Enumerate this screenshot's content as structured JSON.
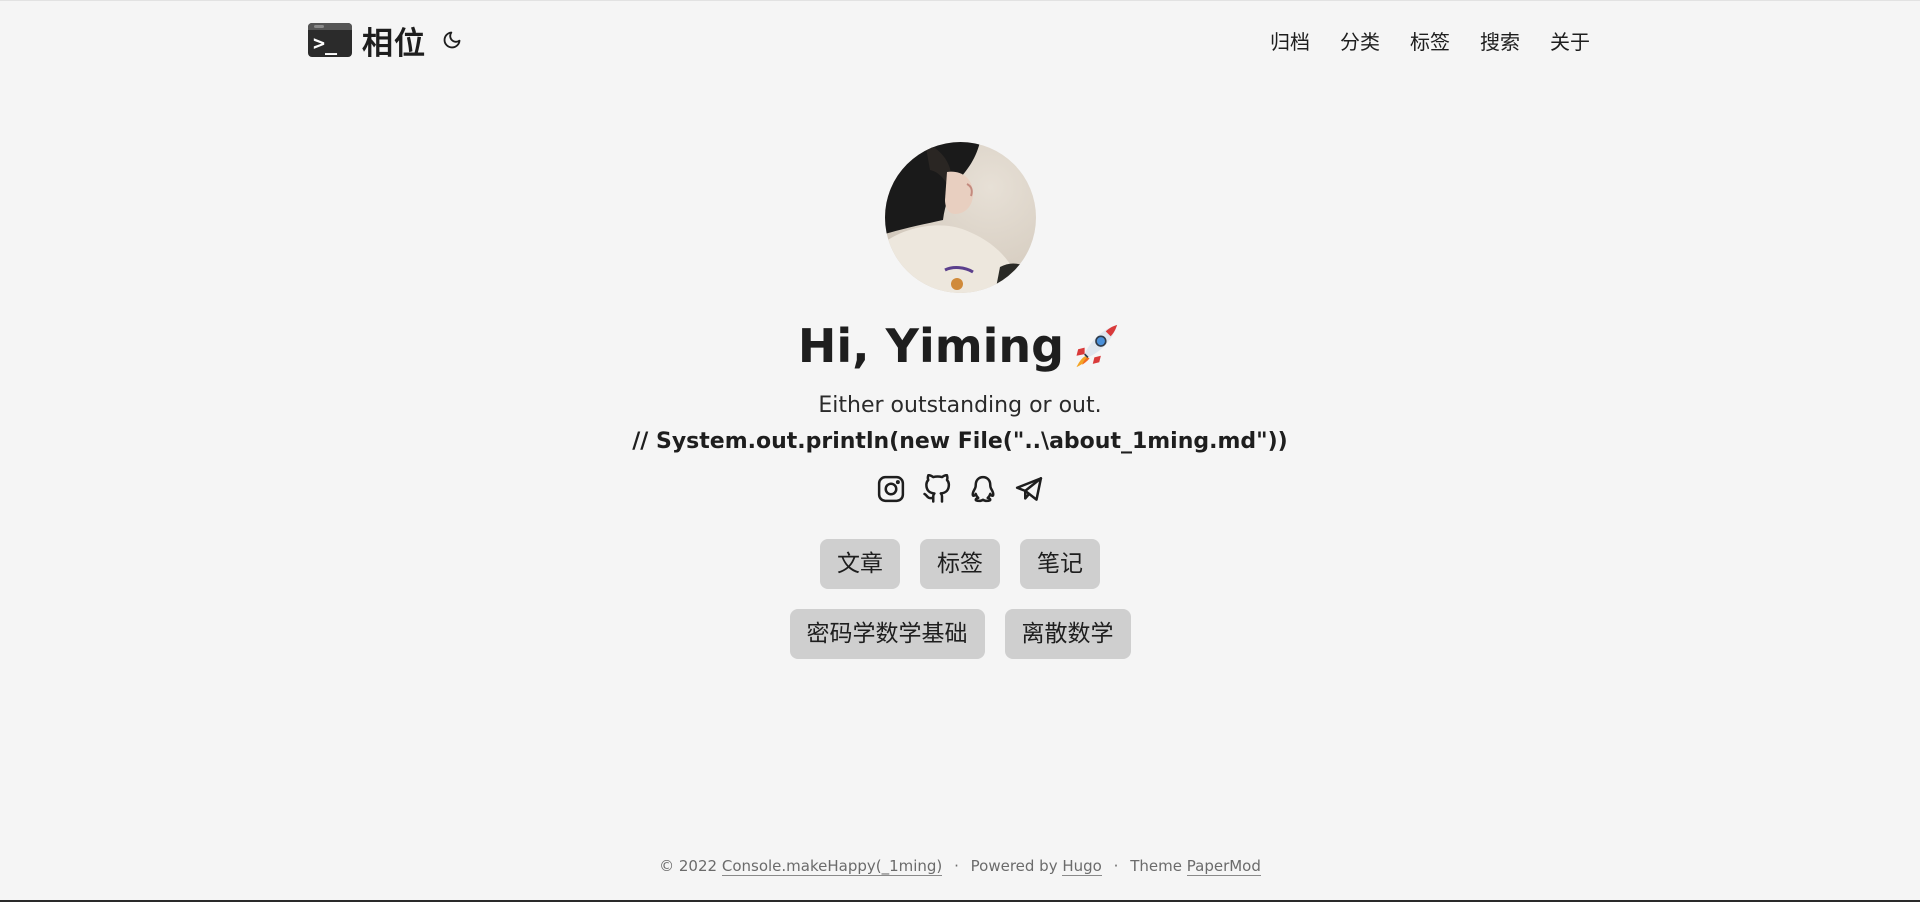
{
  "header": {
    "brand_title": "相位",
    "brand_prompt": ">_",
    "nav": [
      "归档",
      "分类",
      "标签",
      "搜索",
      "关于"
    ]
  },
  "profile": {
    "greeting": "Hi, Yiming",
    "subtitle": "Either outstanding or out.",
    "code_line": "// System.out.println(new File(\"..\\about_1ming.md\"))",
    "social_icons": [
      "instagram-icon",
      "github-icon",
      "qq-icon",
      "telegram-icon"
    ]
  },
  "buttons": {
    "row1": [
      "文章",
      "标签",
      "笔记"
    ],
    "row2": [
      "密码学数学基础",
      "离散数学"
    ]
  },
  "footer": {
    "copyright": "© 2022",
    "site_link": "Console.makeHappy(_1ming)",
    "sep": "·",
    "powered_by": "Powered by",
    "hugo": "Hugo",
    "theme": "Theme",
    "papermod": "PaperMod"
  },
  "colors": {
    "background": "#f5f5f5",
    "text": "#1e1e1e",
    "pill_bg": "#cfcfcf",
    "footer_text": "#6b6b6b"
  }
}
